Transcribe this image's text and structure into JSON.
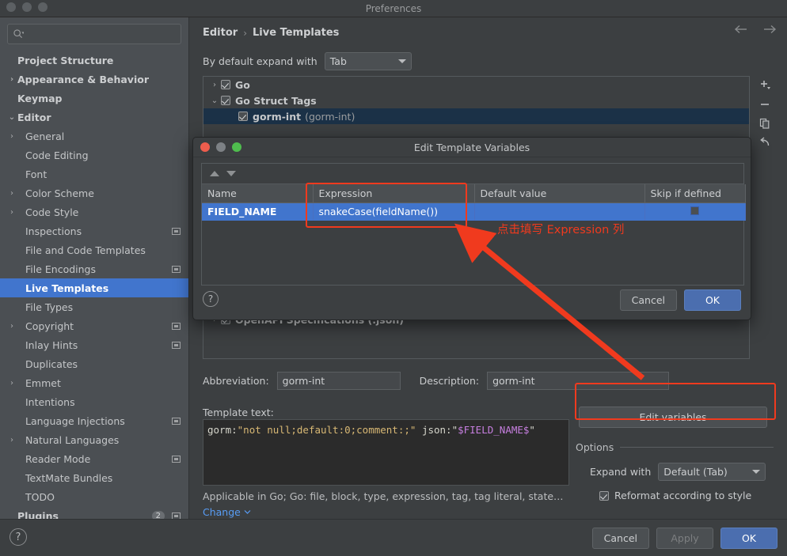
{
  "window": {
    "title": "Preferences"
  },
  "search": {
    "value": "",
    "placeholder": "",
    "icon": "search-icon"
  },
  "sidebar": {
    "items": [
      {
        "label": "Project Structure",
        "arrow": "",
        "level": 0,
        "selected": false,
        "bold": true,
        "mini_icon": false
      },
      {
        "label": "Appearance & Behavior",
        "arrow": "›",
        "level": 0,
        "selected": false,
        "bold": true,
        "mini_icon": false
      },
      {
        "label": "Keymap",
        "arrow": "",
        "level": 0,
        "selected": false,
        "bold": true,
        "mini_icon": false
      },
      {
        "label": "Editor",
        "arrow": "⌄",
        "level": 0,
        "selected": false,
        "bold": true,
        "mini_icon": false
      },
      {
        "label": "General",
        "arrow": "›",
        "level": 1,
        "selected": false,
        "bold": false,
        "mini_icon": false
      },
      {
        "label": "Code Editing",
        "arrow": "",
        "level": 1,
        "selected": false,
        "bold": false,
        "mini_icon": false
      },
      {
        "label": "Font",
        "arrow": "",
        "level": 1,
        "selected": false,
        "bold": false,
        "mini_icon": false
      },
      {
        "label": "Color Scheme",
        "arrow": "›",
        "level": 1,
        "selected": false,
        "bold": false,
        "mini_icon": false
      },
      {
        "label": "Code Style",
        "arrow": "›",
        "level": 1,
        "selected": false,
        "bold": false,
        "mini_icon": false
      },
      {
        "label": "Inspections",
        "arrow": "",
        "level": 1,
        "selected": false,
        "bold": false,
        "mini_icon": true
      },
      {
        "label": "File and Code Templates",
        "arrow": "",
        "level": 1,
        "selected": false,
        "bold": false,
        "mini_icon": false
      },
      {
        "label": "File Encodings",
        "arrow": "",
        "level": 1,
        "selected": false,
        "bold": false,
        "mini_icon": true
      },
      {
        "label": "Live Templates",
        "arrow": "",
        "level": 1,
        "selected": true,
        "bold": false,
        "mini_icon": false
      },
      {
        "label": "File Types",
        "arrow": "",
        "level": 1,
        "selected": false,
        "bold": false,
        "mini_icon": false
      },
      {
        "label": "Copyright",
        "arrow": "›",
        "level": 1,
        "selected": false,
        "bold": false,
        "mini_icon": true
      },
      {
        "label": "Inlay Hints",
        "arrow": "",
        "level": 1,
        "selected": false,
        "bold": false,
        "mini_icon": true
      },
      {
        "label": "Duplicates",
        "arrow": "",
        "level": 1,
        "selected": false,
        "bold": false,
        "mini_icon": false
      },
      {
        "label": "Emmet",
        "arrow": "›",
        "level": 1,
        "selected": false,
        "bold": false,
        "mini_icon": false
      },
      {
        "label": "Intentions",
        "arrow": "",
        "level": 1,
        "selected": false,
        "bold": false,
        "mini_icon": false
      },
      {
        "label": "Language Injections",
        "arrow": "",
        "level": 1,
        "selected": false,
        "bold": false,
        "mini_icon": true
      },
      {
        "label": "Natural Languages",
        "arrow": "›",
        "level": 1,
        "selected": false,
        "bold": false,
        "mini_icon": false
      },
      {
        "label": "Reader Mode",
        "arrow": "",
        "level": 1,
        "selected": false,
        "bold": false,
        "mini_icon": true
      },
      {
        "label": "TextMate Bundles",
        "arrow": "",
        "level": 1,
        "selected": false,
        "bold": false,
        "mini_icon": false
      },
      {
        "label": "TODO",
        "arrow": "",
        "level": 1,
        "selected": false,
        "bold": false,
        "mini_icon": false
      },
      {
        "label": "Plugins",
        "arrow": "",
        "level": 0,
        "selected": false,
        "bold": true,
        "mini_icon": true,
        "badge": "2"
      }
    ]
  },
  "main": {
    "breadcrumb": {
      "root": "Editor",
      "separator": "›",
      "leaf": "Live Templates"
    },
    "nav": {
      "back": "back-arrow",
      "forward": "forward-arrow"
    },
    "expand_row": {
      "label": "By default expand with",
      "value": "Tab"
    },
    "template_tree": [
      {
        "arrow": "›",
        "checked": true,
        "name": "Go",
        "desc": "",
        "indent": 0,
        "selected": false
      },
      {
        "arrow": "⌄",
        "checked": true,
        "name": "Go Struct Tags",
        "desc": "",
        "indent": 0,
        "selected": false
      },
      {
        "arrow": "",
        "checked": true,
        "name": "gorm-int",
        "desc": "(gorm-int)",
        "indent": 1,
        "selected": true
      },
      {
        "arrow": "›",
        "checked": true,
        "name": "OpenAPI Specifications (.json)",
        "desc": "",
        "indent": 0,
        "selected": false
      }
    ],
    "tree_toolbar": [
      {
        "icon": "add-icon",
        "name": "add-template-button"
      },
      {
        "icon": "remove-icon",
        "name": "remove-template-button"
      },
      {
        "icon": "duplicate-icon",
        "name": "duplicate-template-button"
      },
      {
        "icon": "revert-icon",
        "name": "revert-template-button"
      }
    ],
    "abbreviation": {
      "label": "Abbreviation:",
      "value": "gorm-int"
    },
    "description": {
      "label": "Description:",
      "value": "gorm-int"
    },
    "template_text": {
      "label": "Template text:",
      "tokens": [
        {
          "text": "gorm:",
          "kind": "plain"
        },
        {
          "text": "\"not null;default:0;comment:;\"",
          "kind": "string"
        },
        {
          "text": " json:\"",
          "kind": "plain"
        },
        {
          "text": "$FIELD_NAME$",
          "kind": "variable"
        },
        {
          "text": "\"",
          "kind": "plain"
        }
      ],
      "raw": "gorm:\"not null;default:0;comment:;\" json:\"$FIELD_NAME$\""
    },
    "edit_variables_button": "Edit variables",
    "options": {
      "title": "Options",
      "expand_with_label": "Expand with",
      "expand_with_value": "Default (Tab)",
      "reformat_label": "Reformat according to style",
      "reformat_checked": true
    },
    "applicable_text": "Applicable in Go; Go: file, block, type, expression, tag, tag literal, state…",
    "change_link": "Change"
  },
  "dialog": {
    "title": "Edit Template Variables",
    "traffic": {
      "close": "close-button",
      "minimize": "minimize-button",
      "zoom": "zoom-button"
    },
    "sort": {
      "up": "move-up-button",
      "down": "move-down-button"
    },
    "table": {
      "headers": [
        "Name",
        "Expression",
        "Default value",
        "Skip if defined"
      ],
      "rows": [
        {
          "name": "FIELD_NAME",
          "expression": "snakeCase(fieldName())",
          "default_value": "",
          "skip_if_defined": false,
          "selected": true
        }
      ]
    },
    "help": "?",
    "cancel": "Cancel",
    "ok": "OK"
  },
  "footer": {
    "help": "?",
    "cancel": "Cancel",
    "apply": "Apply",
    "ok": "OK"
  },
  "annotations": {
    "note_text": "点击填写 Expression 列",
    "highlight_color": "#f03a1e"
  }
}
